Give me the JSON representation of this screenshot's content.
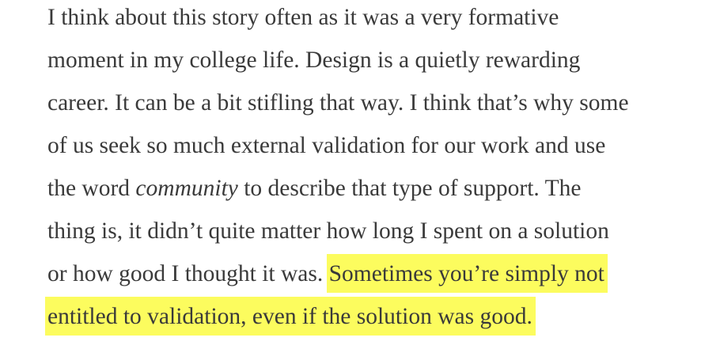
{
  "article": {
    "lines": [
      "I think about this story often as it was a very formative",
      "moment in my college life. Design is a quietly rewarding",
      "career. It can be a bit stifling that way. I think that’s why some",
      "of us seek so much external validation for our work and use",
      "the word "
    ],
    "emphasis_word": "community",
    "line5_rest": " to describe that type of support. The",
    "line6": "thing is, it didn’t quite matter how long I spent on a solution",
    "line7_plain": "or how good I thought it was. ",
    "highlight_line1": "Sometimes you’re simply not",
    "highlight_line2": "entitled to validation, even if the solution was good.",
    "highlight_color": "#fcfc5e",
    "text_color": "#3a3a3a"
  }
}
